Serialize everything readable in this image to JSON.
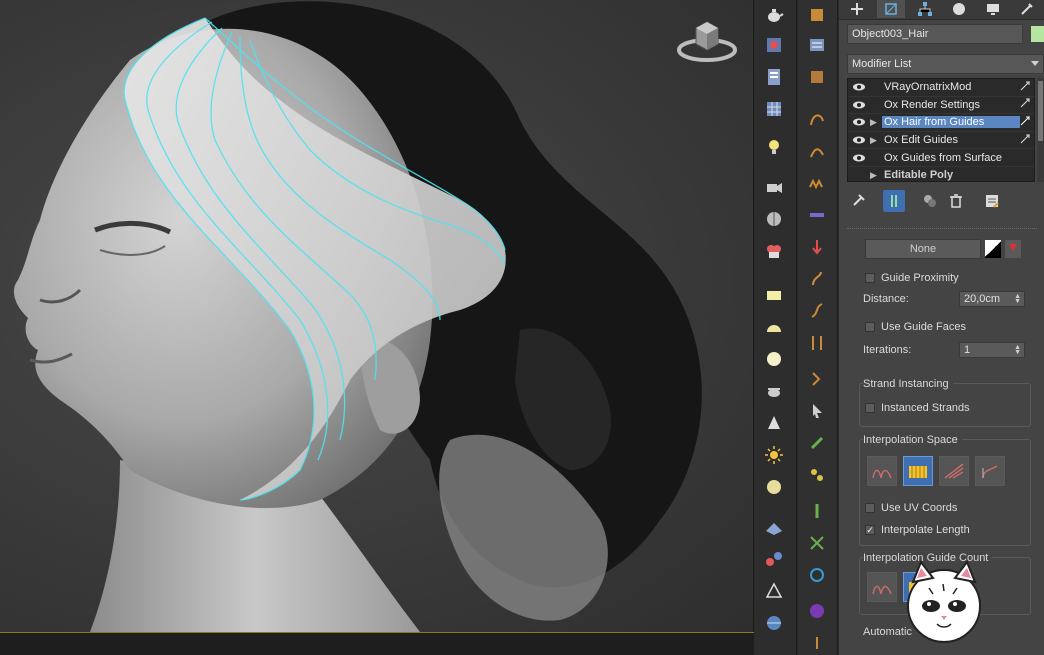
{
  "panel": {
    "object_name": "Object003_Hair",
    "object_color": "#b4e6a0",
    "modifier_list_label": "Modifier List",
    "stack": [
      {
        "label": "VRayOrnatrixMod",
        "expandable": false,
        "selected": false
      },
      {
        "label": "Ox Render Settings",
        "expandable": false,
        "selected": false
      },
      {
        "label": "Ox Hair from Guides",
        "expandable": true,
        "selected": true
      },
      {
        "label": "Ox Edit Guides",
        "expandable": true,
        "selected": false
      },
      {
        "label": "Ox Guides from Surface",
        "expandable": false,
        "selected": false
      },
      {
        "label": "Editable Poly",
        "expandable": true,
        "selected": false
      }
    ]
  },
  "rollout": {
    "none_button": "None",
    "guide_proximity": {
      "label": "Guide Proximity",
      "checked": false
    },
    "distance": {
      "label": "Distance:",
      "value": "20,0cm"
    },
    "use_guide_faces": {
      "label": "Use Guide Faces",
      "checked": false
    },
    "iterations": {
      "label": "Iterations:",
      "value": "1"
    },
    "strand_instancing": {
      "title": "Strand Instancing",
      "instanced_strands": "Instanced Strands",
      "checked": false
    },
    "interpolation_space": {
      "title": "Interpolation Space",
      "use_uv_coords": "Use UV Coords",
      "use_uv_checked": false,
      "interpolate_length": "Interpolate Length",
      "interpolate_length_checked": true
    },
    "interpolation_guide_count": {
      "title": "Interpolation Guide Count"
    },
    "automatic_title": "Automatic"
  },
  "colors": {
    "accent": "#5a86c2",
    "guide_cyan": "#4fe3f0",
    "panel_bg": "#444444"
  },
  "icons": {
    "panel_tabs": [
      "create-icon",
      "modify-icon",
      "hierarchy-icon",
      "motion-icon",
      "display-icon",
      "utilities-icon"
    ],
    "stack_tools": [
      "pin-stack-icon",
      "show-end-result-icon",
      "make-unique-icon",
      "remove-modifier-icon",
      "configure-modifier-sets-icon"
    ]
  }
}
